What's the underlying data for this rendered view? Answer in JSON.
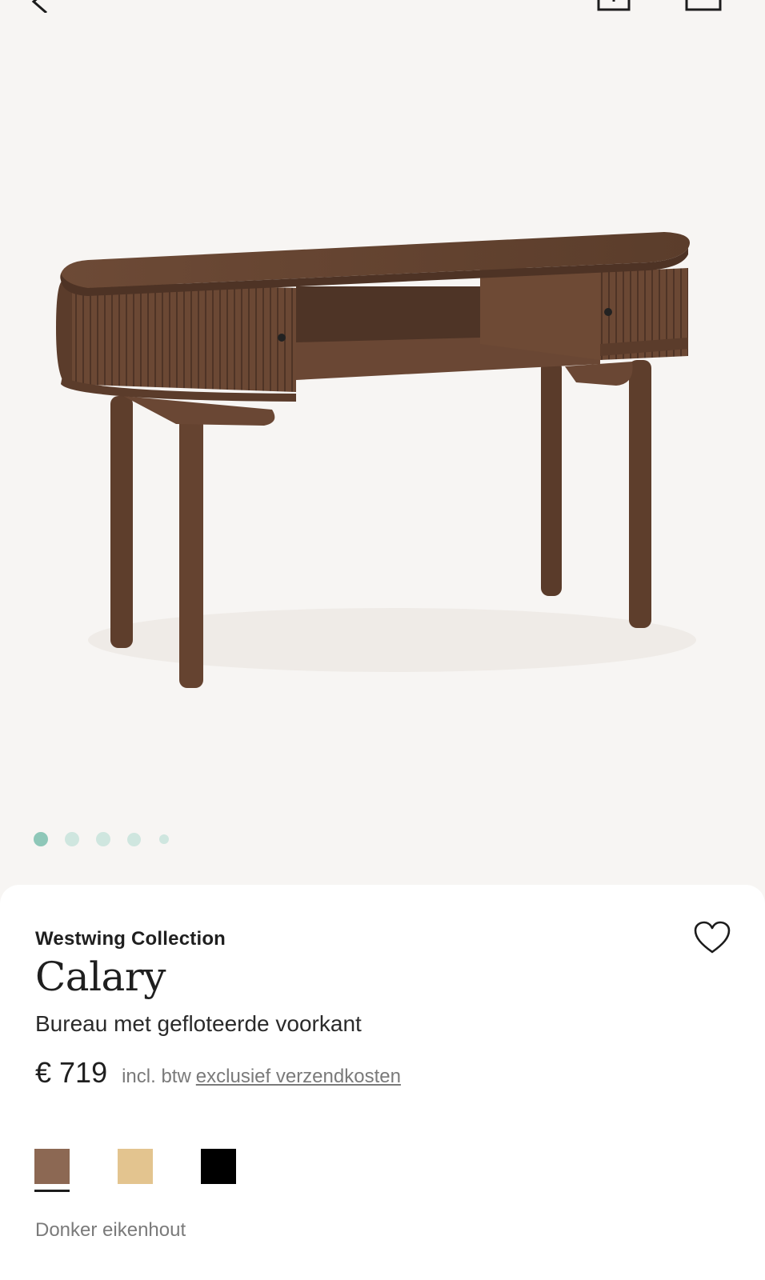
{
  "header": {
    "back_icon": "chevron-left-icon",
    "share_icon": "share-icon",
    "cart_icon": "bag-icon"
  },
  "gallery": {
    "image_subject": "walnut-brown oval desk with fluted tambour doors",
    "dot_count": 5,
    "active_index": 0,
    "colors": {
      "active": "#8ec7b8",
      "inactive": "#cfe6df"
    }
  },
  "product": {
    "brand": "Westwing Collection",
    "name": "Calary",
    "subtitle": "Bureau met gefloteerde voorkant",
    "price": "€ 719",
    "vat_note": "incl. btw",
    "shipping_link": "exclusief verzendkosten",
    "wishlist_icon": "heart-outline-icon"
  },
  "variants": {
    "swatches": [
      {
        "color": "#8c6853",
        "selected": true
      },
      {
        "color": "#e3c48f",
        "selected": false
      },
      {
        "color": "#000000",
        "selected": false
      }
    ],
    "selected_label": "Donker eikenhout"
  }
}
